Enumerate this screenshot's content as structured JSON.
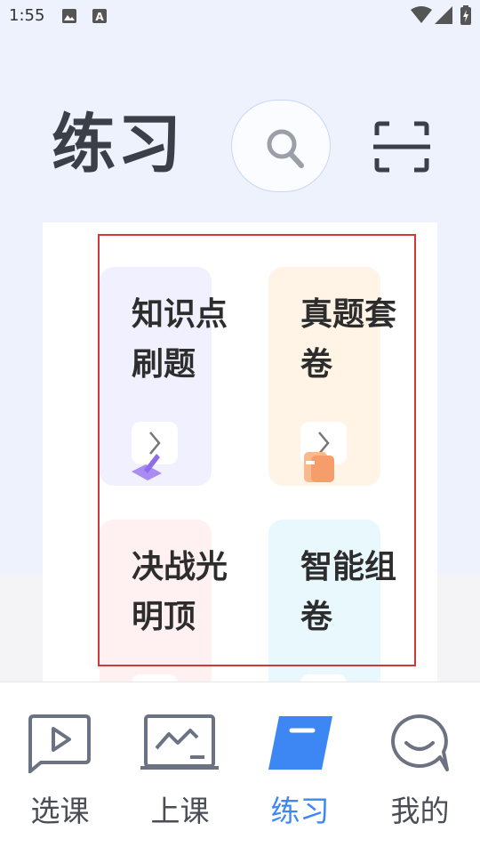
{
  "status_bar": {
    "time": "1:55",
    "icons": [
      "image-icon",
      "a-letter-icon",
      "wifi-icon",
      "signal-icon",
      "battery-icon"
    ]
  },
  "header": {
    "title": "练习",
    "search_icon": "search-icon",
    "scan_icon": "scan-icon"
  },
  "tiles": [
    {
      "label": "知识点\n刷题",
      "bg": "#f1f0fe",
      "icon": "pen-icon"
    },
    {
      "label": "真题套\n卷",
      "bg": "#fff4e6",
      "icon": "book-icon"
    },
    {
      "label": "决战光\n明顶",
      "bg": "#fff0f1",
      "icon": ""
    },
    {
      "label": "智能组\n卷",
      "bg": "#e8f8fc",
      "icon": ""
    }
  ],
  "bottom_nav": [
    {
      "label": "选课",
      "icon": "play-icon",
      "active": false
    },
    {
      "label": "上课",
      "icon": "board-icon",
      "active": false
    },
    {
      "label": "练习",
      "icon": "practice-icon",
      "active": true
    },
    {
      "label": "我的",
      "icon": "chat-face-icon",
      "active": false
    }
  ],
  "colors": {
    "accent": "#3d87f5",
    "highlight_border": "#d0393b",
    "header_bg": "#eef2fd"
  }
}
